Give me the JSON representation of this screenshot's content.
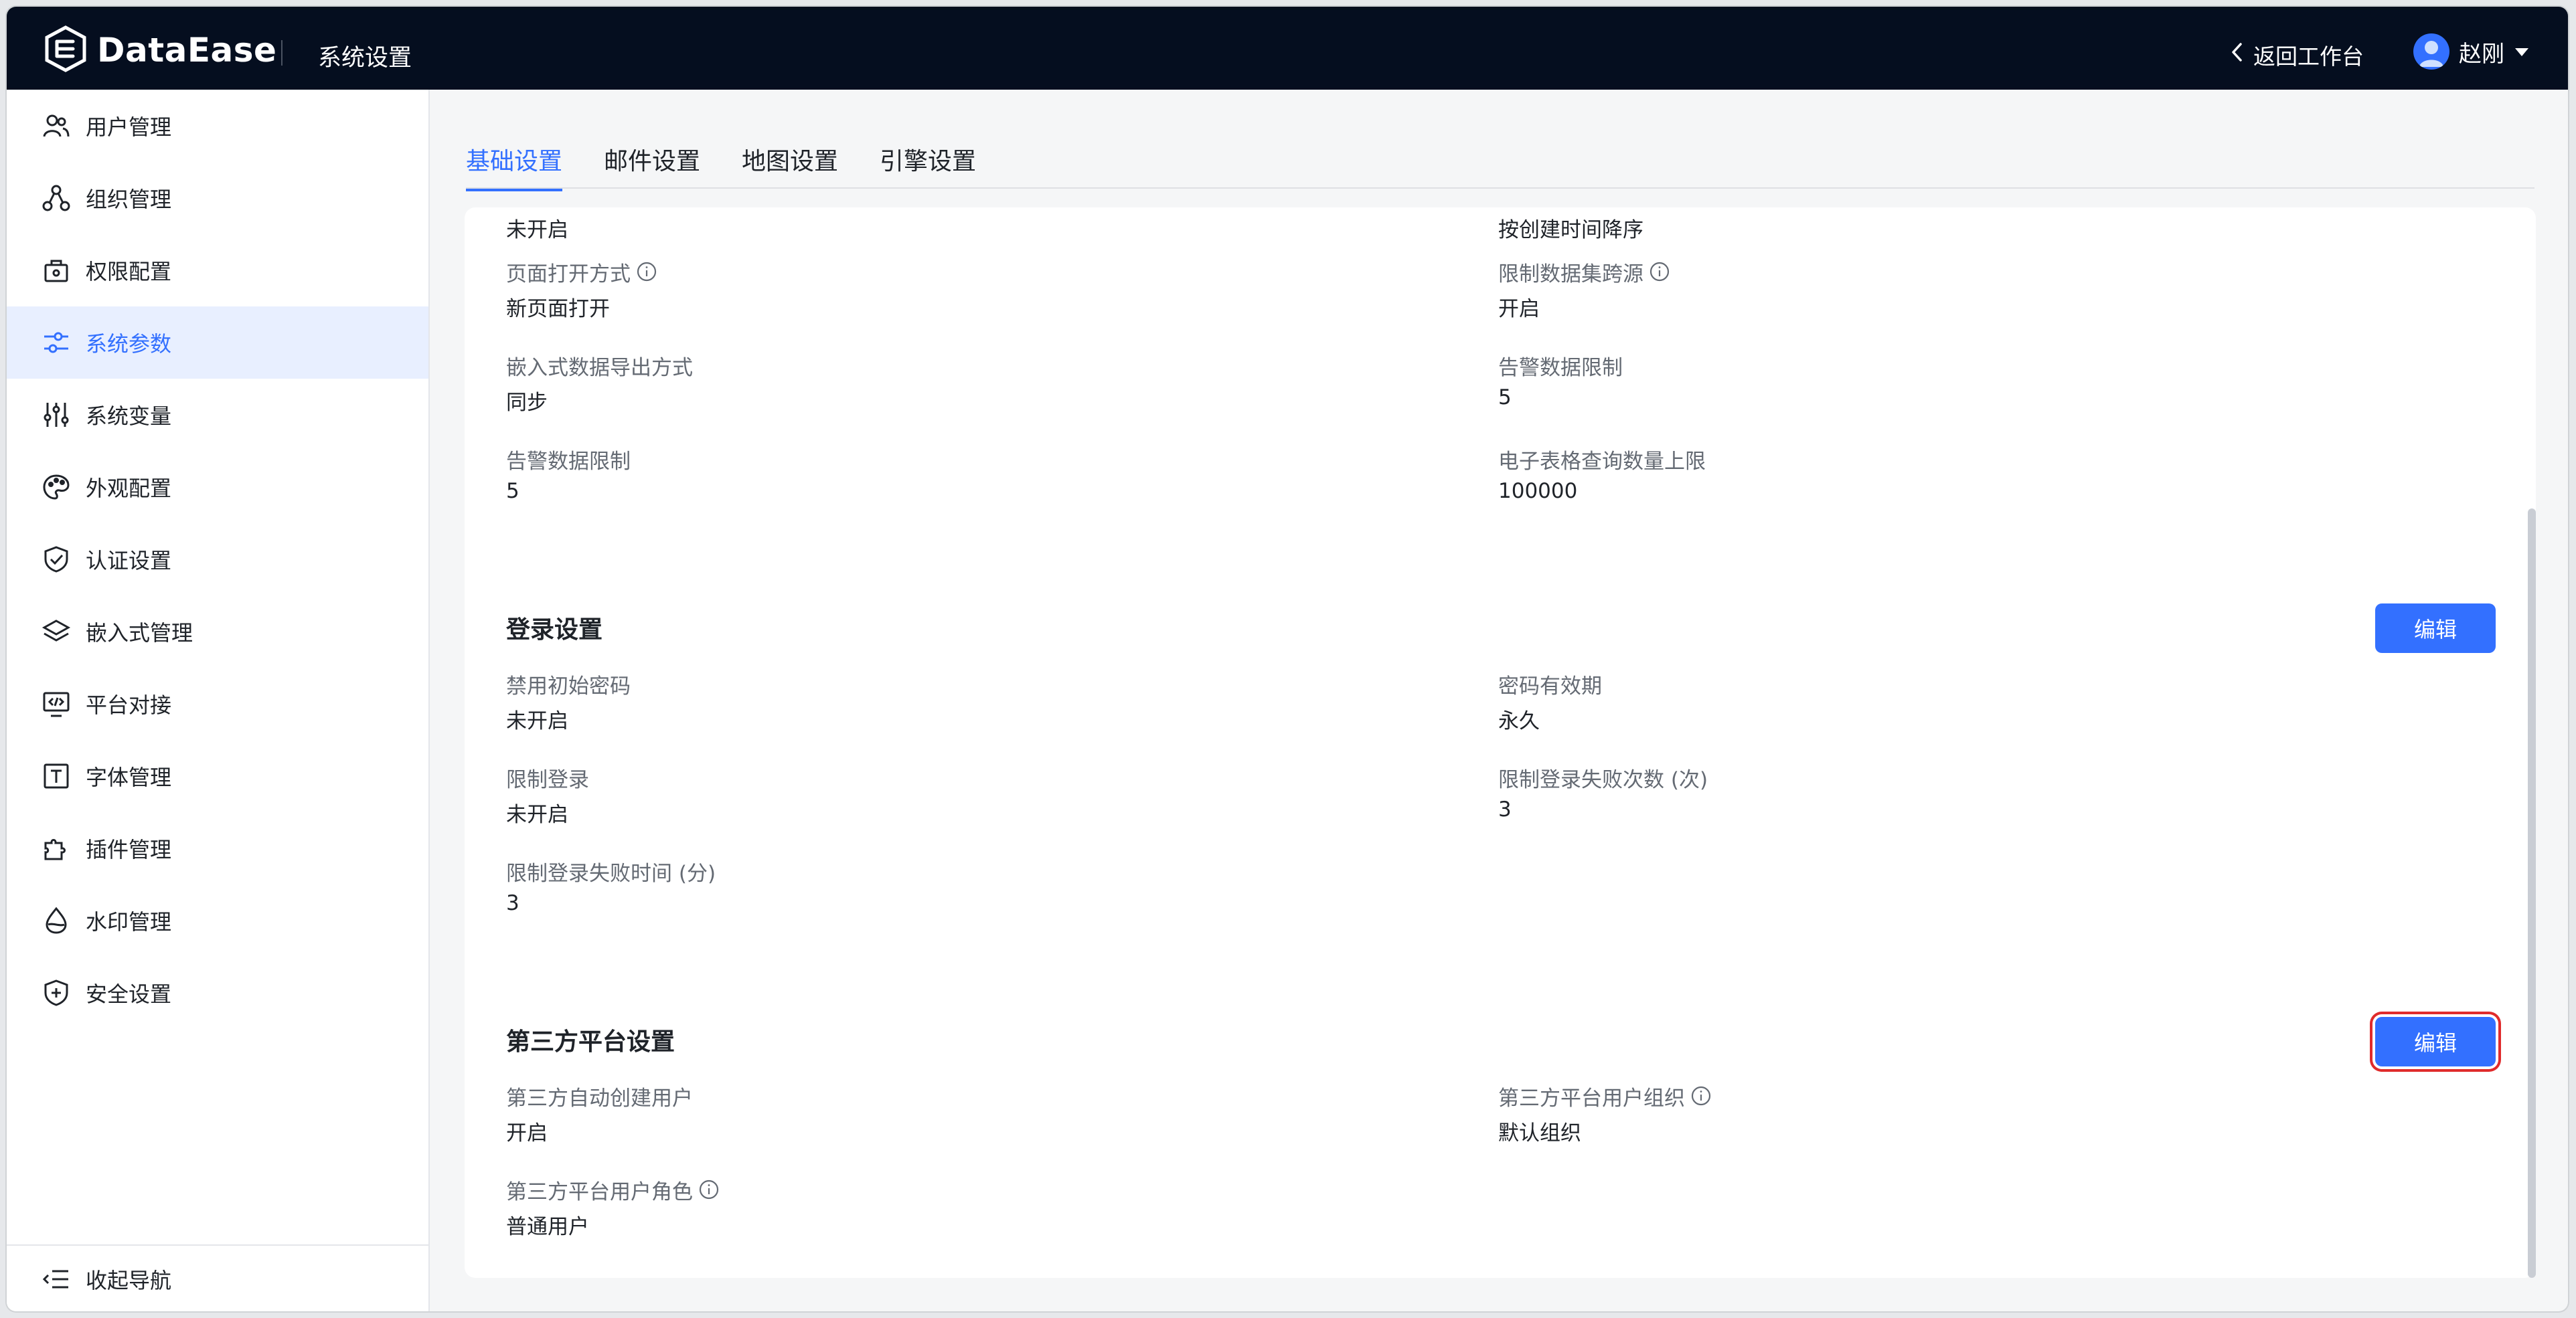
{
  "header": {
    "brand": "DataEase",
    "app_title": "系统设置",
    "back_label": "返回工作台",
    "user_name": "赵刚"
  },
  "sidebar": {
    "items": [
      {
        "label": "用户管理",
        "icon": "users-icon"
      },
      {
        "label": "组织管理",
        "icon": "org-tree-icon"
      },
      {
        "label": "权限配置",
        "icon": "permission-lock-icon"
      },
      {
        "label": "系统参数",
        "icon": "sliders-icon",
        "active": true
      },
      {
        "label": "系统变量",
        "icon": "variables-icon"
      },
      {
        "label": "外观配置",
        "icon": "palette-icon"
      },
      {
        "label": "认证设置",
        "icon": "shield-check-icon"
      },
      {
        "label": "嵌入式管理",
        "icon": "layers-icon"
      },
      {
        "label": "平台对接",
        "icon": "code-monitor-icon"
      },
      {
        "label": "字体管理",
        "icon": "font-icon"
      },
      {
        "label": "插件管理",
        "icon": "puzzle-icon"
      },
      {
        "label": "水印管理",
        "icon": "drop-icon"
      },
      {
        "label": "安全设置",
        "icon": "shield-plus-icon"
      }
    ],
    "collapse_label": "收起导航"
  },
  "tabs": [
    "基础设置",
    "邮件设置",
    "地图设置",
    "引擎设置"
  ],
  "basic": {
    "row0": {
      "left_value": "未开启",
      "right_value": "按创建时间降序"
    },
    "page_open_label": "页面打开方式",
    "page_open_value": "新页面打开",
    "limit_cross_label": "限制数据集跨源",
    "limit_cross_value": "开启",
    "embed_export_label": "嵌入式数据导出方式",
    "embed_export_value": "同步",
    "alert_limit_label_r": "告警数据限制",
    "alert_limit_value_r": "5",
    "alert_limit_label_l": "告警数据限制",
    "alert_limit_value_l": "5",
    "sheet_limit_label": "电子表格查询数量上限",
    "sheet_limit_value": "100000"
  },
  "login": {
    "title": "登录设置",
    "edit_label": "编辑",
    "disable_init_pwd_label": "禁用初始密码",
    "disable_init_pwd_value": "未开启",
    "pwd_valid_label": "密码有效期",
    "pwd_valid_value": "永久",
    "limit_login_label": "限制登录",
    "limit_login_value": "未开启",
    "fail_count_label": "限制登录失败次数 (次)",
    "fail_count_value": "3",
    "fail_time_label": "限制登录失败时间 (分)",
    "fail_time_value": "3"
  },
  "third_party": {
    "title": "第三方平台设置",
    "edit_label": "编辑",
    "auto_create_label": "第三方自动创建用户",
    "auto_create_value": "开启",
    "user_org_label": "第三方平台用户组织",
    "user_org_value": "默认组织",
    "user_role_label": "第三方平台用户角色",
    "user_role_value": "普通用户"
  },
  "colors": {
    "primary": "#3370ff",
    "topbar": "#050e1f",
    "highlight_border": "#e02b2b"
  }
}
